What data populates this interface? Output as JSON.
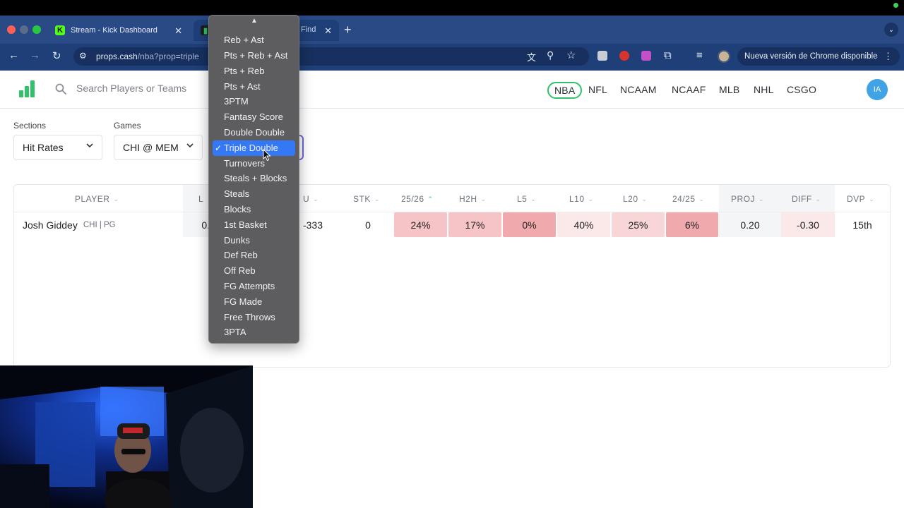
{
  "browser": {
    "tabs": [
      {
        "title": "Stream - Kick Dashboard",
        "favicon": "K"
      },
      {
        "title": "Find",
        "favicon": ""
      }
    ],
    "url_host": "props.cash",
    "url_path": "/nba?prop=triple",
    "update_label": "Nueva versión de Chrome disponible"
  },
  "header": {
    "search_placeholder": "Search Players or Teams",
    "leagues": [
      "NBA",
      "NFL",
      "NCAAM",
      "NCAAF",
      "MLB",
      "NHL",
      "CSGO"
    ],
    "active_league": "NBA",
    "user_initials": "IA"
  },
  "filters": {
    "sections_label": "Sections",
    "sections_value": "Hit Rates",
    "games_label": "Games",
    "games_value": "CHI @ MEM"
  },
  "table": {
    "headers": [
      "PLAYER",
      "L",
      "U",
      "STK",
      "25/26",
      "H2H",
      "L5",
      "L10",
      "L20",
      "24/25",
      "PROJ",
      "DIFF",
      "DVP"
    ],
    "row": {
      "player": "Josh Giddey",
      "team_pos": "CHI | PG",
      "line": "0.",
      "u_odds": "-333",
      "stk": "0",
      "season_2526": "24%",
      "h2h": "17%",
      "l5": "0%",
      "l10": "40%",
      "l20": "25%",
      "season_2425": "6%",
      "proj": "0.20",
      "diff": "-0.30",
      "dvp": "15th"
    }
  },
  "dropdown": {
    "items": [
      "Reb + Ast",
      "Pts + Reb + Ast",
      "Pts + Reb",
      "Pts + Ast",
      "3PTM",
      "Fantasy Score",
      "Double Double",
      "Triple Double",
      "Turnovers",
      "Steals + Blocks",
      "Steals",
      "Blocks",
      "1st Basket",
      "Dunks",
      "Def Reb",
      "Off Reb",
      "FG Attempts",
      "FG Made",
      "Free Throws",
      "3PTA"
    ],
    "selected": "Triple Double"
  },
  "colors": {
    "accent_green": "#2fc26b",
    "cell_light": "#f8dada",
    "cell_mid": "#f6c4c6",
    "cell_strong": "#f0a9ad",
    "highlight_blue": "#3478f6"
  }
}
